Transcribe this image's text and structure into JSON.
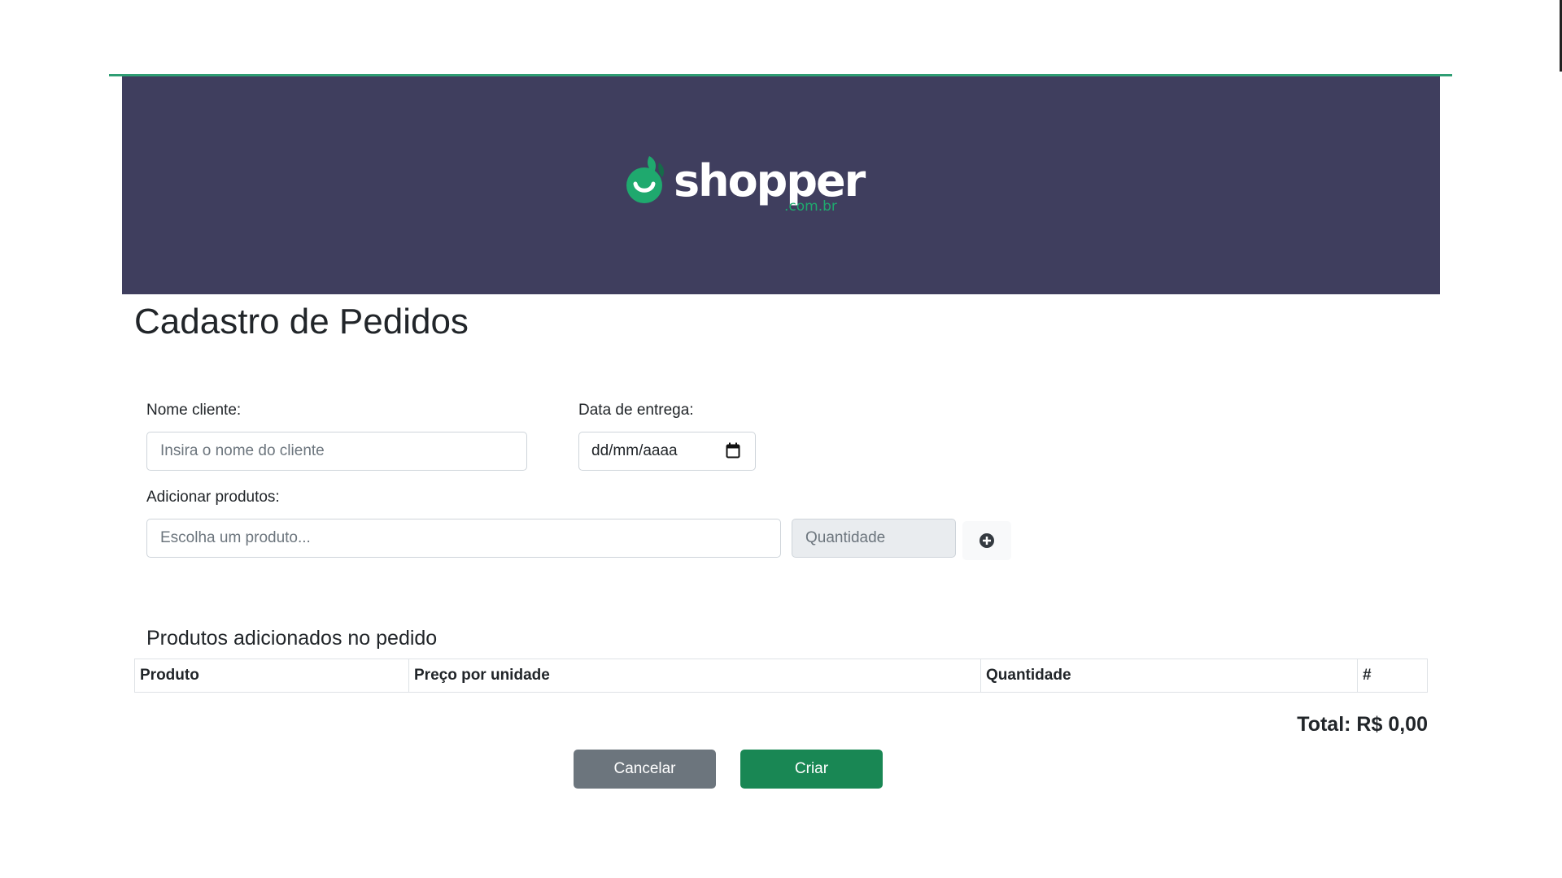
{
  "header": {
    "logo_text": "shopper",
    "logo_sub": ".com.br",
    "logo_colors": {
      "green": "#1fa96e",
      "banner": "#3f3e5e"
    }
  },
  "page_title": "Cadastro de Pedidos",
  "form": {
    "client_label": "Nome cliente:",
    "client_placeholder": "Insira o nome do cliente",
    "client_value": "",
    "delivery_label": "Data de entrega:",
    "delivery_placeholder": "dd/mm/aaaa",
    "products_label": "Adicionar produtos:",
    "product_placeholder": "Escolha um produto...",
    "quantity_placeholder": "Quantidade",
    "add_icon": "plus-circle-icon"
  },
  "order": {
    "section_title": "Produtos adicionados no pedido",
    "columns": [
      "Produto",
      "Preço por unidade",
      "Quantidade",
      "#"
    ],
    "rows": [],
    "total_text": "Total: R$ 0,00"
  },
  "actions": {
    "cancel_label": "Cancelar",
    "create_label": "Criar",
    "colors": {
      "cancel": "#6c757d",
      "create": "#198754"
    }
  }
}
